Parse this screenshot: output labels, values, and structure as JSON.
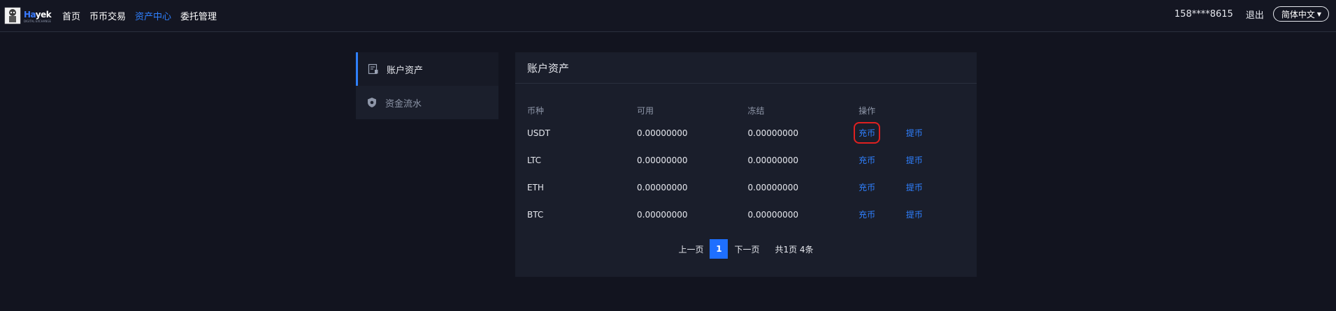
{
  "header": {
    "brand": {
      "ha": "Ha",
      "rest": "yek",
      "tagline": "DIGITAL EXCHANGE"
    },
    "nav": [
      {
        "label": "首页",
        "active": false
      },
      {
        "label": "币币交易",
        "active": false
      },
      {
        "label": "资产中心",
        "active": true
      },
      {
        "label": "委托管理",
        "active": false
      }
    ],
    "phone": "158****8615",
    "logout": "退出",
    "language": "简体中文"
  },
  "sidebar": {
    "items": [
      {
        "label": "账户资产",
        "icon": "wallet-card-icon",
        "active": true
      },
      {
        "label": "资金流水",
        "icon": "shield-icon",
        "active": false
      }
    ]
  },
  "panel": {
    "title": "账户资产",
    "columns": [
      "币种",
      "可用",
      "冻结",
      "操作"
    ],
    "rows": [
      {
        "coin": "USDT",
        "available": "0.00000000",
        "frozen": "0.00000000",
        "deposit": "充币",
        "withdraw": "提币"
      },
      {
        "coin": "LTC",
        "available": "0.00000000",
        "frozen": "0.00000000",
        "deposit": "充币",
        "withdraw": "提币"
      },
      {
        "coin": "ETH",
        "available": "0.00000000",
        "frozen": "0.00000000",
        "deposit": "充币",
        "withdraw": "提币"
      },
      {
        "coin": "BTC",
        "available": "0.00000000",
        "frozen": "0.00000000",
        "deposit": "充币",
        "withdraw": "提币"
      }
    ]
  },
  "pagination": {
    "prev": "上一页",
    "current": "1",
    "next": "下一页",
    "total": "共1页 4条"
  },
  "colors": {
    "accent": "#2f80ff",
    "highlight": "#e02020",
    "background": "#12141f"
  }
}
